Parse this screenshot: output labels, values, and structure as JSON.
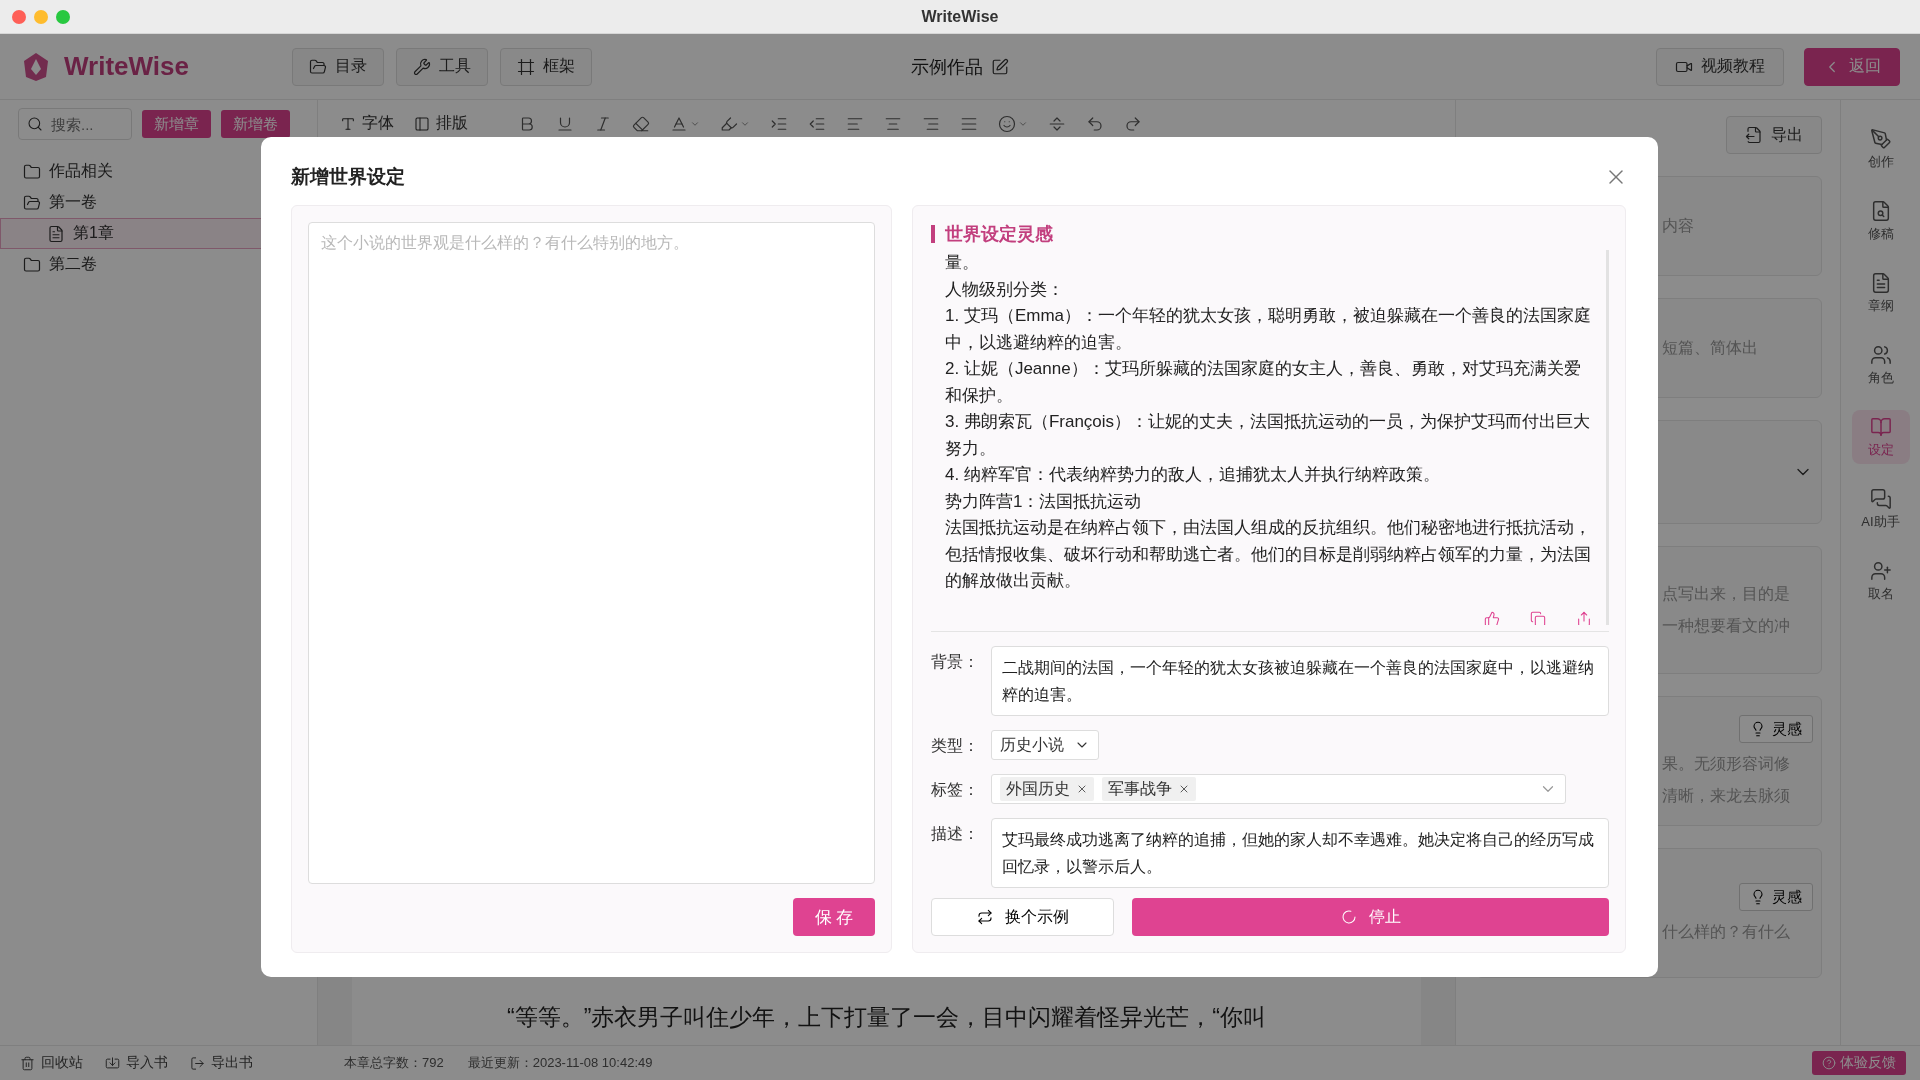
{
  "window": {
    "title": "WriteWise"
  },
  "header": {
    "logo": "WriteWise",
    "nav": [
      {
        "label": "目录",
        "kind": "folder"
      },
      {
        "label": "工具",
        "kind": "wrench"
      },
      {
        "label": "框架",
        "kind": "frame"
      }
    ],
    "work_title": "示例作品",
    "video_button": "视频教程",
    "back_button": "返回"
  },
  "sidebar": {
    "search_placeholder": "搜索...",
    "buttons": [
      "新增章",
      "新增卷"
    ],
    "tree": [
      {
        "label": "作品相关",
        "kind": "folder",
        "expanded": false,
        "selected": false
      },
      {
        "label": "第一卷",
        "kind": "folder",
        "expanded": true,
        "selected": false,
        "children": [
          {
            "label": "第1章",
            "kind": "file",
            "selected": true
          }
        ]
      },
      {
        "label": "第二卷",
        "kind": "folder",
        "expanded": false,
        "selected": false
      }
    ],
    "footer": [
      "回收站",
      "导入书",
      "导出书"
    ]
  },
  "toolbar": {
    "text_buttons": [
      "字体",
      "排版"
    ]
  },
  "editor": {
    "paragraph": "“等等。”赤衣男子叫住少年，上下打量了一会，目中闪耀着怪异光芒，“你叫"
  },
  "right_panel": {
    "export_button": "导出",
    "cards": [
      {
        "kind": "text",
        "lines": [
          "内容"
        ]
      },
      {
        "kind": "text",
        "lines": [
          "短篇、简体出"
        ]
      },
      {
        "kind": "select"
      },
      {
        "kind": "text",
        "lines": [
          "点写出来，目的是",
          "一种想要看文的冲"
        ]
      },
      {
        "kind": "idea",
        "button": "灵感",
        "lines": [
          "果。无须形容词修",
          "清晰，来龙去脉须"
        ]
      },
      {
        "kind": "idea",
        "button": "灵感",
        "lines": [
          "什么样的？有什么"
        ]
      }
    ]
  },
  "rail": [
    {
      "label": "创作",
      "kind": "pen",
      "selected": false
    },
    {
      "label": "修稿",
      "kind": "review",
      "selected": false
    },
    {
      "label": "章纲",
      "kind": "outline",
      "selected": false
    },
    {
      "label": "角色",
      "kind": "users",
      "selected": false
    },
    {
      "label": "设定",
      "kind": "book",
      "selected": true
    },
    {
      "label": "AI助手",
      "kind": "chat",
      "selected": false
    },
    {
      "label": "取名",
      "kind": "user-plus",
      "selected": false
    }
  ],
  "status_bar": {
    "word_count": "本章总字数：792",
    "updated": "最近更新：2023-11-08 10:42:49",
    "feedback": "体验反馈"
  },
  "modal": {
    "title": "新增世界设定",
    "input": {
      "placeholder": "这个小说的世界观是什么样的？有什么特别的地方。"
    },
    "save_button": "保 存",
    "inspiration": {
      "title": "世界设定灵感",
      "paragraphs": [
        "量。",
        "人物级别分类：",
        "1. 艾玛（Emma）：一个年轻的犹太女孩，聪明勇敢，被迫躲藏在一个善良的法国家庭中，以逃避纳粹的迫害。",
        "2. 让妮（Jeanne）：艾玛所躲藏的法国家庭的女主人，善良、勇敢，对艾玛充满关爱和保护。",
        "3. 弗朗索瓦（François）：让妮的丈夫，法国抵抗运动的一员，为保护艾玛而付出巨大努力。",
        "4. 纳粹军官：代表纳粹势力的敌人，追捕犹太人并执行纳粹政策。",
        "势力阵营1：法国抵抗运动",
        "法国抵抗运动是在纳粹占领下，由法国人组成的反抗组织。他们秘密地进行抵抗活动，包括情报收集、破坏行动和帮助逃亡者。他们的目标是削弱纳粹占领军的力量，为法国的解放做出贡献。"
      ]
    },
    "fields": [
      {
        "label": "背景：",
        "kind": "text",
        "value": "二战期间的法国，一个年轻的犹太女孩被迫躲藏在一个善良的法国家庭中，以逃避纳粹的迫害。"
      },
      {
        "label": "类型：",
        "kind": "select",
        "value": "历史小说"
      },
      {
        "label": "标签：",
        "kind": "tags",
        "tags": [
          "外国历史",
          "军事战争"
        ]
      },
      {
        "label": "描述：",
        "kind": "text",
        "value": "艾玛最终成功逃离了纳粹的追捕，但她的家人却不幸遇难。她决定将自己的经历写成回忆录，以警示后人。"
      }
    ],
    "change_button": "换个示例",
    "stop_button": "停止",
    "generating": true
  }
}
